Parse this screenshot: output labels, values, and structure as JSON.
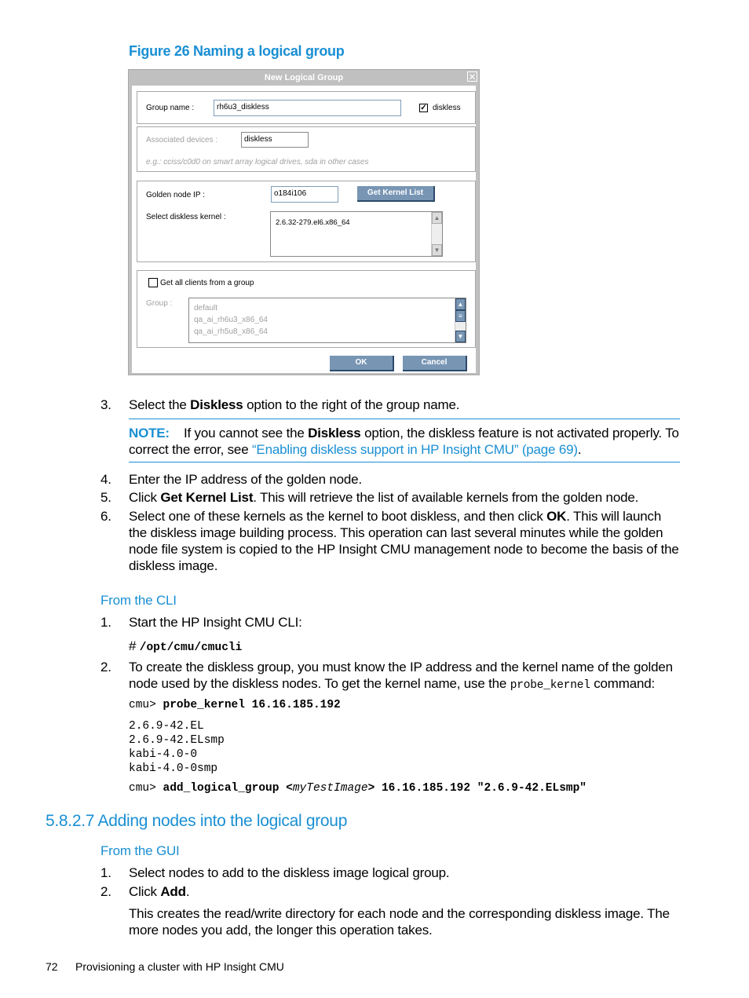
{
  "figure": {
    "caption": "Figure 26 Naming a logical group"
  },
  "dialog": {
    "title": "New Logical Group",
    "close_icon": "close-icon",
    "group_name_label": "Group name :",
    "group_name_value": "rh6u3_diskless",
    "diskless_checkbox_label": "diskless",
    "diskless_checked": true,
    "associated_devices_label": "Associated devices :",
    "associated_devices_value": "diskless",
    "associated_devices_hint": "e.g.: cciss/c0d0 on smart array logical drives, sda in other cases",
    "golden_node_ip_label": "Golden node IP :",
    "golden_node_ip_value": "o184i106",
    "get_kernel_list_button": "Get Kernel List",
    "select_kernel_label": "Select diskless kernel :",
    "kernels": [
      "2.6.32-279.el6.x86_64"
    ],
    "get_all_clients_label": "Get all clients from a group",
    "get_all_clients_checked": false,
    "group_label": "Group :",
    "groups": [
      "default",
      "qa_ai_rh6u3_x86_64",
      "qa_ai_rh5u8_x86_64"
    ],
    "ok_button": "OK",
    "cancel_button": "Cancel"
  },
  "steps_a": [
    {
      "num": "3.",
      "pre": "Select the ",
      "bold": "Diskless",
      "post": " option to the right of the group name."
    }
  ],
  "note": {
    "label": "NOTE:",
    "pre": "If you cannot see the ",
    "bold": "Diskless",
    "post": " option, the diskless feature is not activated properly. To correct the error, see ",
    "link": "“Enabling diskless support in HP Insight CMU” (page 69)",
    "end": "."
  },
  "steps_b": [
    {
      "num": "4.",
      "text": "Enter the IP address of the golden node."
    },
    {
      "num": "5.",
      "pre": "Click ",
      "bold": "Get Kernel List",
      "post": ". This will retrieve the list of available kernels from the golden node."
    },
    {
      "num": "6.",
      "pre": "Select one of these kernels as the kernel to boot diskless, and then click ",
      "bold": "OK",
      "post": ". This will launch the diskless image building process. This operation can last several minutes while the golden node file system is copied to the HP Insight CMU management node to become the basis of the diskless image."
    }
  ],
  "cli": {
    "heading": "From the CLI",
    "step1_num": "1.",
    "step1_text": "Start the HP Insight CMU CLI:",
    "step1_prompt": "# ",
    "step1_cmd": "/opt/cmu/cmucli",
    "step2_num": "2.",
    "step2_pre": "To create the diskless group, you must know the IP address and the kernel name of the golden node used by the diskless nodes. To get the kernel name, use the ",
    "step2_code": "probe_kernel",
    "step2_post": " command:",
    "prompt": "cmu>",
    "probe_cmd": "probe_kernel 16.16.185.192",
    "output": [
      "2.6.9-42.EL",
      "2.6.9-42.ELsmp",
      "kabi-4.0-0",
      "kabi-4.0-0smp"
    ],
    "add_cmd_a": "add_logical_group <",
    "add_cmd_italic": "myTestImage",
    "add_cmd_b": "> 16.16.185.192 \"2.6.9-42.ELsmp\""
  },
  "section": {
    "heading": "5.8.2.7 Adding nodes into the logical group",
    "gui_heading": "From the GUI",
    "steps": [
      {
        "num": "1.",
        "text": "Select nodes to add to the diskless image logical group."
      },
      {
        "num": "2.",
        "pre": "Click ",
        "bold": "Add",
        "post": "."
      }
    ],
    "para": "This creates the read/write directory for each node and the corresponding diskless image. The more nodes you add, the longer this operation takes."
  },
  "footer": {
    "page_number": "72",
    "title": "Provisioning a cluster with HP Insight CMU"
  }
}
